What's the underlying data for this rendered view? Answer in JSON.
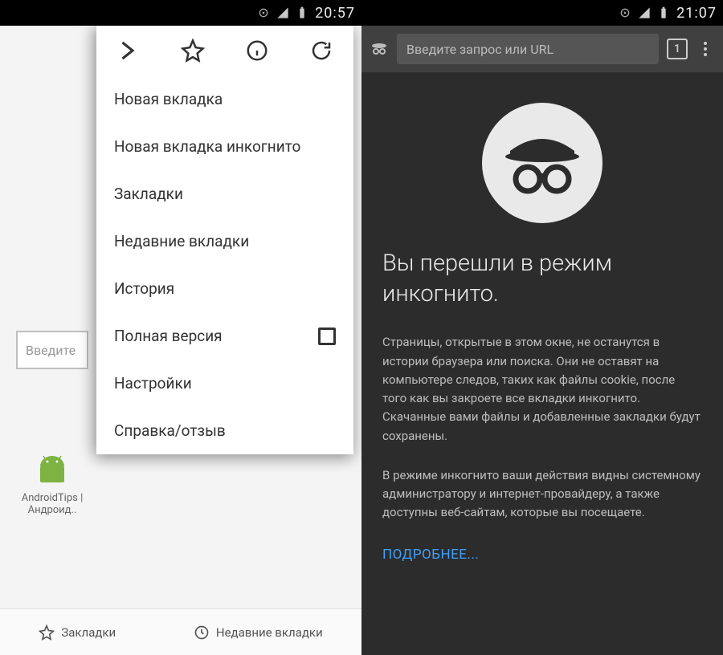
{
  "left": {
    "status": {
      "time": "20:57"
    },
    "search_placeholder": "Введите",
    "app_tile": {
      "line1": "AndroidTips |",
      "line2": "Андроид.."
    },
    "menu": {
      "items": [
        "Новая вкладка",
        "Новая вкладка инкогнито",
        "Закладки",
        "Недавние вкладки",
        "История",
        "Полная версия",
        "Настройки",
        "Справка/отзыв"
      ]
    },
    "bottom": {
      "bookmarks": "Закладки",
      "recent": "Недавние вкладки"
    }
  },
  "right": {
    "status": {
      "time": "21:07"
    },
    "url_placeholder": "Введите запрос или URL",
    "tab_count": "1",
    "title": "Вы перешли в режим инкогнито.",
    "para1": "Страницы, открытые в этом окне, не останутся в истории браузера или поиска. Они не оставят на компьютере следов, таких как файлы cookie, после того как вы закроете все вкладки инкогнито. Скачанные вами файлы и добавленные закладки будут сохранены.",
    "para2": "В режиме инкогнито ваши действия видны системному администратору и интернет-провайдеру, а также доступны веб-сайтам, которые вы посещаете.",
    "more": "ПОДРОБНЕЕ..."
  }
}
